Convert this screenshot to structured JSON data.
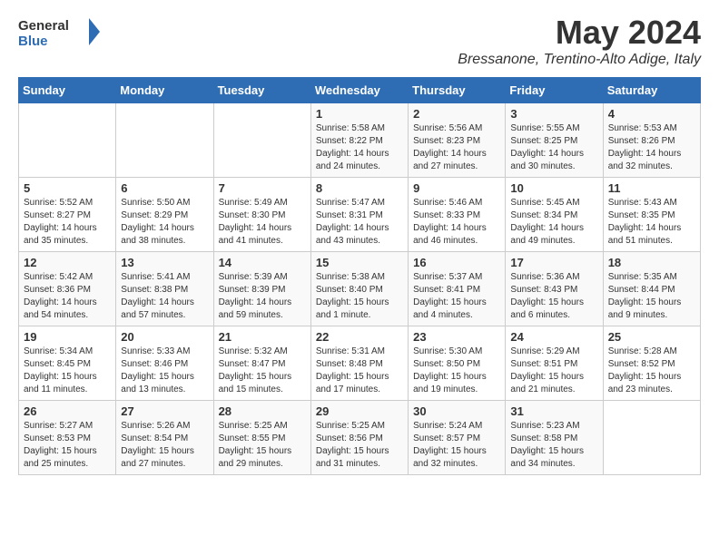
{
  "header": {
    "logo_general": "General",
    "logo_blue": "Blue",
    "month_title": "May 2024",
    "location": "Bressanone, Trentino-Alto Adige, Italy"
  },
  "days_of_week": [
    "Sunday",
    "Monday",
    "Tuesday",
    "Wednesday",
    "Thursday",
    "Friday",
    "Saturday"
  ],
  "weeks": [
    {
      "days": [
        {
          "num": "",
          "info": ""
        },
        {
          "num": "",
          "info": ""
        },
        {
          "num": "",
          "info": ""
        },
        {
          "num": "1",
          "info": "Sunrise: 5:58 AM\nSunset: 8:22 PM\nDaylight: 14 hours\nand 24 minutes."
        },
        {
          "num": "2",
          "info": "Sunrise: 5:56 AM\nSunset: 8:23 PM\nDaylight: 14 hours\nand 27 minutes."
        },
        {
          "num": "3",
          "info": "Sunrise: 5:55 AM\nSunset: 8:25 PM\nDaylight: 14 hours\nand 30 minutes."
        },
        {
          "num": "4",
          "info": "Sunrise: 5:53 AM\nSunset: 8:26 PM\nDaylight: 14 hours\nand 32 minutes."
        }
      ]
    },
    {
      "days": [
        {
          "num": "5",
          "info": "Sunrise: 5:52 AM\nSunset: 8:27 PM\nDaylight: 14 hours\nand 35 minutes."
        },
        {
          "num": "6",
          "info": "Sunrise: 5:50 AM\nSunset: 8:29 PM\nDaylight: 14 hours\nand 38 minutes."
        },
        {
          "num": "7",
          "info": "Sunrise: 5:49 AM\nSunset: 8:30 PM\nDaylight: 14 hours\nand 41 minutes."
        },
        {
          "num": "8",
          "info": "Sunrise: 5:47 AM\nSunset: 8:31 PM\nDaylight: 14 hours\nand 43 minutes."
        },
        {
          "num": "9",
          "info": "Sunrise: 5:46 AM\nSunset: 8:33 PM\nDaylight: 14 hours\nand 46 minutes."
        },
        {
          "num": "10",
          "info": "Sunrise: 5:45 AM\nSunset: 8:34 PM\nDaylight: 14 hours\nand 49 minutes."
        },
        {
          "num": "11",
          "info": "Sunrise: 5:43 AM\nSunset: 8:35 PM\nDaylight: 14 hours\nand 51 minutes."
        }
      ]
    },
    {
      "days": [
        {
          "num": "12",
          "info": "Sunrise: 5:42 AM\nSunset: 8:36 PM\nDaylight: 14 hours\nand 54 minutes."
        },
        {
          "num": "13",
          "info": "Sunrise: 5:41 AM\nSunset: 8:38 PM\nDaylight: 14 hours\nand 57 minutes."
        },
        {
          "num": "14",
          "info": "Sunrise: 5:39 AM\nSunset: 8:39 PM\nDaylight: 14 hours\nand 59 minutes."
        },
        {
          "num": "15",
          "info": "Sunrise: 5:38 AM\nSunset: 8:40 PM\nDaylight: 15 hours\nand 1 minute."
        },
        {
          "num": "16",
          "info": "Sunrise: 5:37 AM\nSunset: 8:41 PM\nDaylight: 15 hours\nand 4 minutes."
        },
        {
          "num": "17",
          "info": "Sunrise: 5:36 AM\nSunset: 8:43 PM\nDaylight: 15 hours\nand 6 minutes."
        },
        {
          "num": "18",
          "info": "Sunrise: 5:35 AM\nSunset: 8:44 PM\nDaylight: 15 hours\nand 9 minutes."
        }
      ]
    },
    {
      "days": [
        {
          "num": "19",
          "info": "Sunrise: 5:34 AM\nSunset: 8:45 PM\nDaylight: 15 hours\nand 11 minutes."
        },
        {
          "num": "20",
          "info": "Sunrise: 5:33 AM\nSunset: 8:46 PM\nDaylight: 15 hours\nand 13 minutes."
        },
        {
          "num": "21",
          "info": "Sunrise: 5:32 AM\nSunset: 8:47 PM\nDaylight: 15 hours\nand 15 minutes."
        },
        {
          "num": "22",
          "info": "Sunrise: 5:31 AM\nSunset: 8:48 PM\nDaylight: 15 hours\nand 17 minutes."
        },
        {
          "num": "23",
          "info": "Sunrise: 5:30 AM\nSunset: 8:50 PM\nDaylight: 15 hours\nand 19 minutes."
        },
        {
          "num": "24",
          "info": "Sunrise: 5:29 AM\nSunset: 8:51 PM\nDaylight: 15 hours\nand 21 minutes."
        },
        {
          "num": "25",
          "info": "Sunrise: 5:28 AM\nSunset: 8:52 PM\nDaylight: 15 hours\nand 23 minutes."
        }
      ]
    },
    {
      "days": [
        {
          "num": "26",
          "info": "Sunrise: 5:27 AM\nSunset: 8:53 PM\nDaylight: 15 hours\nand 25 minutes."
        },
        {
          "num": "27",
          "info": "Sunrise: 5:26 AM\nSunset: 8:54 PM\nDaylight: 15 hours\nand 27 minutes."
        },
        {
          "num": "28",
          "info": "Sunrise: 5:25 AM\nSunset: 8:55 PM\nDaylight: 15 hours\nand 29 minutes."
        },
        {
          "num": "29",
          "info": "Sunrise: 5:25 AM\nSunset: 8:56 PM\nDaylight: 15 hours\nand 31 minutes."
        },
        {
          "num": "30",
          "info": "Sunrise: 5:24 AM\nSunset: 8:57 PM\nDaylight: 15 hours\nand 32 minutes."
        },
        {
          "num": "31",
          "info": "Sunrise: 5:23 AM\nSunset: 8:58 PM\nDaylight: 15 hours\nand 34 minutes."
        },
        {
          "num": "",
          "info": ""
        }
      ]
    }
  ]
}
